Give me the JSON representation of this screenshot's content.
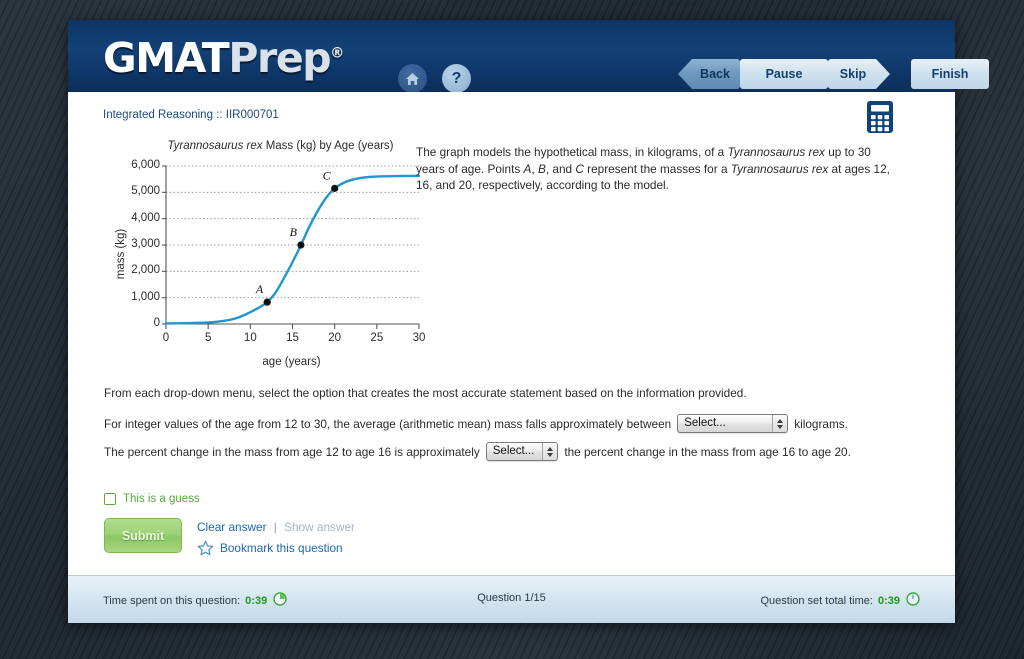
{
  "header": {
    "logo_gmat": "GMAT",
    "logo_prep": "Prep",
    "logo_registered": "®",
    "home_icon": "home-icon",
    "help_icon": "question-mark-icon",
    "nav": {
      "back": "Back",
      "pause": "Pause",
      "skip": "Skip",
      "finish": "Finish"
    }
  },
  "subheader": {
    "breadcrumb": "Integrated Reasoning :: IIR000701",
    "calculator_icon": "calculator-icon"
  },
  "prompt": {
    "part1": "The graph models the hypothetical mass, in kilograms, of a ",
    "italic1": "Tyrannosaurus rex",
    "part2": " up to 30 years of age. Points ",
    "italicA": "A",
    "part3": ", ",
    "italicB": "B",
    "part4": ", and ",
    "italicC": "C",
    "part5": " represent the masses for a ",
    "italic2": "Tyrannosaurus rex",
    "part6": " at ages 12, 16, and 20, respectively, according to the model."
  },
  "instruction": "From each drop-down menu, select the option that creates the most accurate statement based on the information provided.",
  "statements": [
    {
      "before": "For integer values of the age from 12 to 30, the average (arithmetic mean) mass falls approximately between",
      "select_value": "Select...",
      "after": "kilograms."
    },
    {
      "before": "The percent change in the mass from age 12 to age 16 is approximately",
      "select_value": "Select...",
      "after": "the percent change in the mass from age 16 to age 20."
    }
  ],
  "controls": {
    "guess_label": "This is a guess",
    "guess_checked": false,
    "submit_label": "Submit",
    "clear_answer": "Clear answer",
    "separator": "|",
    "show_answer": "Show answer",
    "bookmark_label": "Bookmark this question",
    "bookmark_icon": "star-outline-icon"
  },
  "footer": {
    "time_spent_label": "Time spent on this question:",
    "time_spent_value": "0:39",
    "question_counter": "Question 1/15",
    "total_time_label": "Question set total time:",
    "total_time_value": "0:39",
    "clock_icon": "clock-icon"
  },
  "colors": {
    "header_blue": "#124176",
    "curve_blue": "#2196cf",
    "accent_link": "#1c69b0",
    "green": "#56a63d",
    "timer_green": "#1a9a1a"
  },
  "chart_data": {
    "type": "line",
    "title": "Tyrannosaurus rex Mass (kg) by Age (years)",
    "title_italic_part": "Tyrannosaurus rex",
    "title_rest": " Mass (kg) by Age (years)",
    "xlabel": "age (years)",
    "ylabel": "mass (kg)",
    "xlim": [
      0,
      30
    ],
    "ylim": [
      0,
      6000
    ],
    "xticks": [
      0,
      5,
      10,
      15,
      20,
      25,
      30
    ],
    "xtick_labels": [
      "0",
      "5",
      "10",
      "15",
      "20",
      "25",
      "30"
    ],
    "yticks": [
      0,
      1000,
      2000,
      3000,
      4000,
      5000,
      6000
    ],
    "ytick_labels": [
      "0",
      "1,000",
      "2,000",
      "3,000",
      "4,000",
      "5,000",
      "6,000"
    ],
    "grid": "horizontal-dotted",
    "legend": "none",
    "series": [
      {
        "name": "hypothetical mass",
        "color": "#2196cf",
        "x": [
          0,
          2,
          4,
          5,
          6,
          7,
          8,
          9,
          10,
          11,
          12,
          13,
          14,
          15,
          16,
          17,
          18,
          19,
          20,
          21,
          22,
          23,
          24,
          25,
          26,
          27,
          28,
          30
        ],
        "y": [
          20,
          28,
          45,
          60,
          85,
          125,
          190,
          300,
          450,
          620,
          830,
          1200,
          1750,
          2350,
          3000,
          3700,
          4300,
          4800,
          5150,
          5350,
          5470,
          5540,
          5580,
          5600,
          5610,
          5615,
          5620,
          5625
        ]
      }
    ],
    "points": [
      {
        "label": "A",
        "x": 12,
        "y": 830
      },
      {
        "label": "B",
        "x": 16,
        "y": 3000
      },
      {
        "label": "C",
        "x": 20,
        "y": 5150
      }
    ]
  }
}
